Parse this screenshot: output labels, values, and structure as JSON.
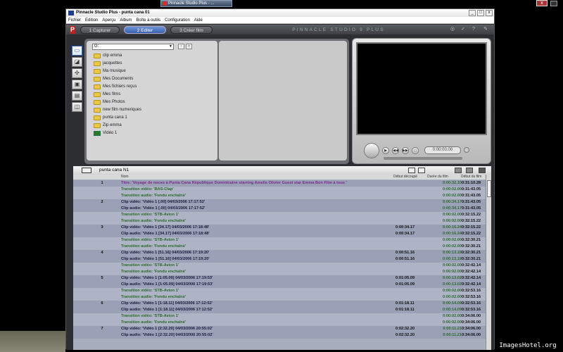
{
  "taskbar": {
    "app_button": "Pinnacle Studio Plus - ...",
    "close_label": "x"
  },
  "window": {
    "title": "Pinnacle Studio Plus - punta cana 01",
    "minimize": "_",
    "maximize": "□",
    "close": "x"
  },
  "menu": [
    "Fichier",
    "Edition",
    "Aperçu",
    "Album",
    "Boîte à outils",
    "Configuration",
    "Aide"
  ],
  "modes": {
    "tab1": "1 Capturer",
    "tab2": "2 Editer",
    "tab3": "3 Créer film",
    "brand": "PINNACLE STUDIO 9 PLUS",
    "active": "2 Editer"
  },
  "album": {
    "path": "G:",
    "folders": [
      "clip emma",
      "jacquettes",
      "Ma musique",
      "Mes Documents",
      "Mes fichiers reçus",
      "Mes films",
      "Mes Photos",
      "new film numeriques",
      "punta cana 1",
      "Zip emma",
      "Vidéo 1"
    ]
  },
  "player": {
    "timecode": "0:00:00.00"
  },
  "timeline": {
    "project_name": "punta cana N1",
    "columns": {
      "name": "Nom",
      "cut": "Début découpé",
      "duration": "Durée du film",
      "start": "Début du film"
    },
    "rows": [
      {
        "num": "1",
        "type": "title",
        "name": "Titre: 'Voyage de noces à Punta Cana République Dominicaine starring Amelie Olivier Guest star Emma Bon Film à tous '",
        "cut": "",
        "dur": "0:00:32.10",
        "start": "0:31:10.28"
      },
      {
        "num": "",
        "type": "trans",
        "name": "Transition vidéo: 'BAS-Clap'",
        "cut": "",
        "dur": "0:00:02.00",
        "start": "0:31:43.05"
      },
      {
        "num": "",
        "type": "trans",
        "name": "Transition audio: 'Fondu enchaîné'",
        "cut": "",
        "dur": "0:00:02.00",
        "start": "0:31:43.05"
      },
      {
        "num": "2",
        "type": "clip",
        "name": "Clip vidéo: 'Vidéo 1 [.00]  04/03/2006 17:17:52'",
        "cut": "",
        "dur": "0:00:34.17",
        "start": "0:31:43.05"
      },
      {
        "num": "",
        "type": "clip",
        "name": "Clip audio: 'Vidéo 1 [.00]  04/03/2006 17:17:52'",
        "cut": "",
        "dur": "0:00:34.17",
        "start": "0:31:43.05"
      },
      {
        "num": "",
        "type": "trans",
        "name": "Transition vidéo: 'STB-Avion 1'",
        "cut": "",
        "dur": "0:00:02.00",
        "start": "0:32:15.22"
      },
      {
        "num": "",
        "type": "trans",
        "name": "Transition audio: 'Fondu enchaîné'",
        "cut": "",
        "dur": "0:00:02.00",
        "start": "0:32:15.22"
      },
      {
        "num": "3",
        "type": "clip",
        "name": "Clip vidéo: 'Vidéo 1 [34.17]  04/03/2006 17:18:48'",
        "cut": "0:00:34.17",
        "dur": "0:00:16.24",
        "start": "0:32:15.22"
      },
      {
        "num": "",
        "type": "clip",
        "name": "Clip audio: 'Vidéo 1 [34.17]  04/03/2006 17:18:48'",
        "cut": "0:00:34.17",
        "dur": "0:00:16.24",
        "start": "0:32:15.22"
      },
      {
        "num": "",
        "type": "trans",
        "name": "Transition vidéo: 'STB-Avion 1'",
        "cut": "",
        "dur": "0:00:02.00",
        "start": "0:32:30.21"
      },
      {
        "num": "",
        "type": "trans",
        "name": "Transition audio: 'Fondu enchaîné'",
        "cut": "",
        "dur": "0:00:02.00",
        "start": "0:32:30.21"
      },
      {
        "num": "4",
        "type": "clip",
        "name": "Clip vidéo: 'Vidéo 1 [51.16]  04/03/2006 17:19:20'",
        "cut": "0:00:51.16",
        "dur": "0:00:13.18",
        "start": "0:32:30.21"
      },
      {
        "num": "",
        "type": "clip",
        "name": "Clip audio: 'Vidéo 1 [51.16]  04/03/2006 17:19:20'",
        "cut": "0:00:51.16",
        "dur": "0:00:13.18",
        "start": "0:32:30.21"
      },
      {
        "num": "",
        "type": "trans",
        "name": "Transition vidéo: 'STB-Avion 1'",
        "cut": "",
        "dur": "0:00:02.00",
        "start": "0:32:42.14"
      },
      {
        "num": "",
        "type": "trans",
        "name": "Transition audio: 'Fondu enchaîné'",
        "cut": "",
        "dur": "0:00:02.00",
        "start": "0:32:42.14"
      },
      {
        "num": "5",
        "type": "clip",
        "name": "Clip vidéo: 'Vidéo 1 [1:05.09]  04/03/2006 17:19:53'",
        "cut": "0:01:05.09",
        "dur": "0:00:13.02",
        "start": "0:32:42.14"
      },
      {
        "num": "",
        "type": "clip",
        "name": "Clip audio: 'Vidéo 1 [1:05.09]  04/03/2006 17:19:53'",
        "cut": "0:01:05.09",
        "dur": "0:00:13.02",
        "start": "0:32:42.14"
      },
      {
        "num": "",
        "type": "trans",
        "name": "Transition vidéo: 'STB-Avion 1'",
        "cut": "",
        "dur": "0:00:02.00",
        "start": "0:32:53.16"
      },
      {
        "num": "",
        "type": "trans",
        "name": "Transition audio: 'Fondu enchaîné'",
        "cut": "",
        "dur": "0:00:02.00",
        "start": "0:32:53.16"
      },
      {
        "num": "6",
        "type": "clip",
        "name": "Clip vidéo: 'Vidéo 1 [1:18.11]  04/03/2006 17:12:52'",
        "cut": "0:01:18.11",
        "dur": "0:00:14.09",
        "start": "0:32:53.16"
      },
      {
        "num": "",
        "type": "clip",
        "name": "Clip audio: 'Vidéo 1 [1:18.11]  04/03/2006 17:12:52'",
        "cut": "0:01:18.11",
        "dur": "0:00:14.09",
        "start": "0:32:53.16"
      },
      {
        "num": "",
        "type": "trans",
        "name": "Transition vidéo: 'STB-Avion 1'",
        "cut": "",
        "dur": "0:00:02.00",
        "start": "0:34:06.00"
      },
      {
        "num": "",
        "type": "trans",
        "name": "Transition audio: 'Fondu enchaîné'",
        "cut": "",
        "dur": "0:00:02.00",
        "start": "0:34:06.00"
      },
      {
        "num": "7",
        "type": "clip",
        "name": "Clip vidéo: 'Vidéo 1 [2:32.20]  04/03/2006 20:55:02'",
        "cut": "0:02:32.20",
        "dur": "0:00:11.21",
        "start": "0:34:06.00"
      },
      {
        "num": "",
        "type": "clip",
        "name": "Clip audio: 'Vidéo 1 [2:32.20]  04/03/2006 20:55:02'",
        "cut": "0:02:32.20",
        "dur": "0:00:11.21",
        "start": "0:34:06.00"
      }
    ]
  },
  "watermark": "ImagesHotel.org",
  "colors": {
    "title": "#7a2a8c",
    "transition": "#2a6a2a",
    "clip": "#1a1a3a",
    "active_tab": "#3a5fae"
  }
}
